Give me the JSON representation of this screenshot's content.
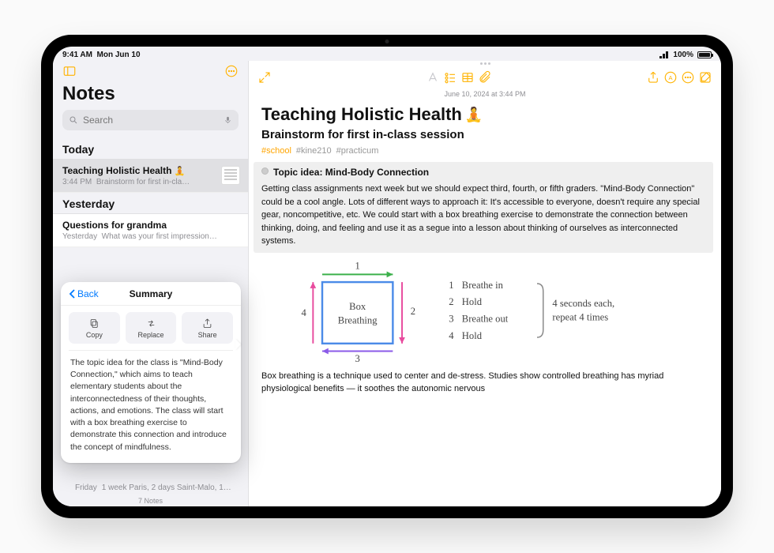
{
  "status": {
    "time": "9:41 AM",
    "date": "Mon Jun 10",
    "battery": "100%"
  },
  "sidebar": {
    "title": "Notes",
    "search_placeholder": "Search",
    "sections": {
      "today_label": "Today",
      "yesterday_label": "Yesterday"
    },
    "today": [
      {
        "title": "Teaching Holistic Health",
        "emoji": "🧘",
        "time": "3:44 PM",
        "preview": "Brainstorm for first in-cla…"
      }
    ],
    "yesterday": [
      {
        "title": "Questions for grandma",
        "time": "Yesterday",
        "preview": "What was your first impression…"
      }
    ],
    "footer_row": {
      "day": "Friday",
      "text": "1 week Paris, 2 days Saint-Malo, 1…"
    },
    "count": "7 Notes"
  },
  "popover": {
    "back": "Back",
    "title": "Summary",
    "actions": {
      "copy": "Copy",
      "replace": "Replace",
      "share": "Share"
    },
    "body": "The topic idea for the class is \"Mind-Body Connection,\" which aims to teach elementary students about the interconnectedness of their thoughts, actions, and emotions. The class will start with a box breathing exercise to demonstrate this connection and introduce the concept of mindfulness."
  },
  "editor": {
    "date": "June 10, 2024 at 3:44 PM",
    "title": "Teaching Holistic Health",
    "emoji": "🧘",
    "subtitle": "Brainstorm for first in-class session",
    "tags": [
      "#school",
      "#kine210",
      "#practicum"
    ],
    "topic_label": "Topic idea: Mind-Body Connection",
    "body1": "Getting class assignments next week but we should expect third, fourth, or fifth graders. \"Mind-Body Connection\" could be a cool angle. Lots of different ways to approach it: It's accessible to everyone, doesn't require any special gear, noncompetitive, etc. We could start with a box breathing exercise to demonstrate the connection between thinking, doing, and feeling and use it as a segue into a lesson about thinking of ourselves as interconnected systems.",
    "drawing": {
      "box_label": "Box\nBreathing",
      "sides": [
        "1",
        "2",
        "3",
        "4"
      ],
      "steps": [
        "Breathe in",
        "Hold",
        "Breathe out",
        "Hold"
      ],
      "note": "4 seconds each,\nrepeat 4 times"
    },
    "body2": "Box breathing is a technique used to center and de-stress. Studies show controlled breathing has myriad physiological benefits — it soothes the autonomic nervous"
  }
}
